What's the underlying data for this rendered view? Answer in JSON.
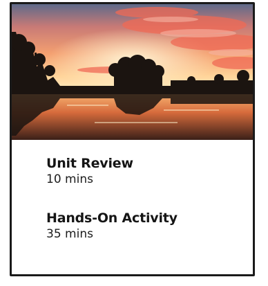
{
  "card": {
    "image": {
      "description_icon": "sunset-lake-image"
    },
    "items": [
      {
        "title": "Unit Review",
        "duration": "10 mins"
      },
      {
        "title": "Hands-On Activity",
        "duration": "35 mins"
      }
    ]
  },
  "colors": {
    "border": "#1a1a1a",
    "text": "#151515",
    "sky_orange": "#f08a4b",
    "sky_pink": "#f3a59a"
  }
}
